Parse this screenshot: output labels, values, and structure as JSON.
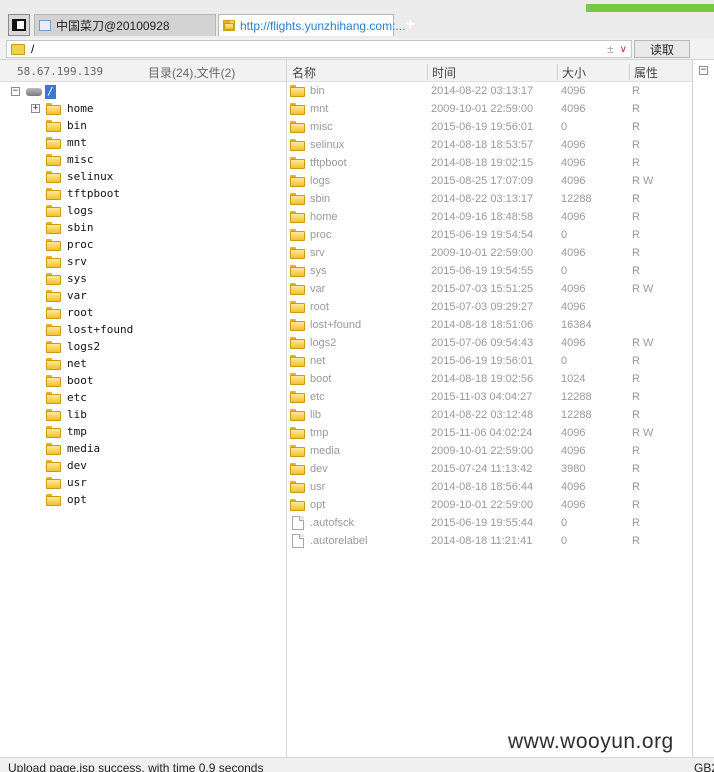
{
  "tabs": [
    {
      "label": "中国菜刀@20100928",
      "active": false
    },
    {
      "label": "http://flights.yunzhihang.com:...",
      "active": true
    }
  ],
  "new_tab_label": "+",
  "address": {
    "path": "/",
    "plus_minus": "±",
    "dropdown": "∨",
    "read_button": "读取"
  },
  "left": {
    "ip": "58.67.199.139",
    "summary": "目录(24),文件(2)",
    "root_label": "/",
    "root_expander": "−",
    "tree": [
      {
        "name": "home",
        "expander": "+"
      },
      {
        "name": "bin"
      },
      {
        "name": "mnt"
      },
      {
        "name": "misc"
      },
      {
        "name": "selinux"
      },
      {
        "name": "tftpboot"
      },
      {
        "name": "logs"
      },
      {
        "name": "sbin"
      },
      {
        "name": "proc"
      },
      {
        "name": "srv"
      },
      {
        "name": "sys"
      },
      {
        "name": "var"
      },
      {
        "name": "root"
      },
      {
        "name": "lost+found"
      },
      {
        "name": "logs2"
      },
      {
        "name": "net"
      },
      {
        "name": "boot"
      },
      {
        "name": "etc"
      },
      {
        "name": "lib"
      },
      {
        "name": "tmp"
      },
      {
        "name": "media"
      },
      {
        "name": "dev"
      },
      {
        "name": "usr"
      },
      {
        "name": "opt"
      }
    ]
  },
  "list": {
    "headers": {
      "name": "名称",
      "time": "时间",
      "size": "大小",
      "attr": "属性"
    },
    "rows": [
      {
        "type": "folder",
        "name": "bin",
        "time": "2014-08-22 03:13:17",
        "size": "4096",
        "attr": "R"
      },
      {
        "type": "folder",
        "name": "mnt",
        "time": "2009-10-01 22:59:00",
        "size": "4096",
        "attr": "R"
      },
      {
        "type": "folder",
        "name": "misc",
        "time": "2015-06-19 19:56:01",
        "size": "0",
        "attr": "R"
      },
      {
        "type": "folder",
        "name": "selinux",
        "time": "2014-08-18 18:53:57",
        "size": "4096",
        "attr": "R"
      },
      {
        "type": "folder",
        "name": "tftpboot",
        "time": "2014-08-18 19:02:15",
        "size": "4096",
        "attr": "R"
      },
      {
        "type": "folder",
        "name": "logs",
        "time": "2015-08-25 17:07:09",
        "size": "4096",
        "attr": "R W"
      },
      {
        "type": "folder",
        "name": "sbin",
        "time": "2014-08-22 03:13:17",
        "size": "12288",
        "attr": "R"
      },
      {
        "type": "folder",
        "name": "home",
        "time": "2014-09-16 18:48:58",
        "size": "4096",
        "attr": "R"
      },
      {
        "type": "folder",
        "name": "proc",
        "time": "2015-06-19 19:54:54",
        "size": "0",
        "attr": "R"
      },
      {
        "type": "folder",
        "name": "srv",
        "time": "2009-10-01 22:59:00",
        "size": "4096",
        "attr": "R"
      },
      {
        "type": "folder",
        "name": "sys",
        "time": "2015-06-19 19:54:55",
        "size": "0",
        "attr": "R"
      },
      {
        "type": "folder",
        "name": "var",
        "time": "2015-07-03 15:51:25",
        "size": "4096",
        "attr": "R W"
      },
      {
        "type": "folder",
        "name": "root",
        "time": "2015-07-03 09:29:27",
        "size": "4096",
        "attr": ""
      },
      {
        "type": "folder",
        "name": "lost+found",
        "time": "2014-08-18 18:51:06",
        "size": "16384",
        "attr": ""
      },
      {
        "type": "folder",
        "name": "logs2",
        "time": "2015-07-06 09:54:43",
        "size": "4096",
        "attr": "R W"
      },
      {
        "type": "folder",
        "name": "net",
        "time": "2015-06-19 19:56:01",
        "size": "0",
        "attr": "R"
      },
      {
        "type": "folder",
        "name": "boot",
        "time": "2014-08-18 19:02:56",
        "size": "1024",
        "attr": "R"
      },
      {
        "type": "folder",
        "name": "etc",
        "time": "2015-11-03 04:04:27",
        "size": "12288",
        "attr": "R"
      },
      {
        "type": "folder",
        "name": "lib",
        "time": "2014-08-22 03:12:48",
        "size": "12288",
        "attr": "R"
      },
      {
        "type": "folder",
        "name": "tmp",
        "time": "2015-11-06 04:02:24",
        "size": "4096",
        "attr": "R W"
      },
      {
        "type": "folder",
        "name": "media",
        "time": "2009-10-01 22:59:00",
        "size": "4096",
        "attr": "R"
      },
      {
        "type": "folder",
        "name": "dev",
        "time": "2015-07-24 11:13:42",
        "size": "3980",
        "attr": "R"
      },
      {
        "type": "folder",
        "name": "usr",
        "time": "2014-08-18 18:56:44",
        "size": "4096",
        "attr": "R"
      },
      {
        "type": "folder",
        "name": "opt",
        "time": "2009-10-01 22:59:00",
        "size": "4096",
        "attr": "R"
      },
      {
        "type": "file",
        "name": ".autofsck",
        "time": "2015-06-19 19:55:44",
        "size": "0",
        "attr": "R"
      },
      {
        "type": "file",
        "name": ".autorelabel",
        "time": "2014-08-18 11:21:41",
        "size": "0",
        "attr": "R"
      }
    ]
  },
  "right_strip_collapse": "−",
  "status": {
    "message": "Upload page.jsp success, with time 0.9 seconds",
    "encoding": "GB2"
  },
  "watermark": "www.wooyun.org",
  "colors": {
    "accent": "#3a78d4",
    "tab_active_text": "#2a7fd3",
    "progress_green": "#7ac943",
    "folder_yellow": "#f2c22d"
  }
}
